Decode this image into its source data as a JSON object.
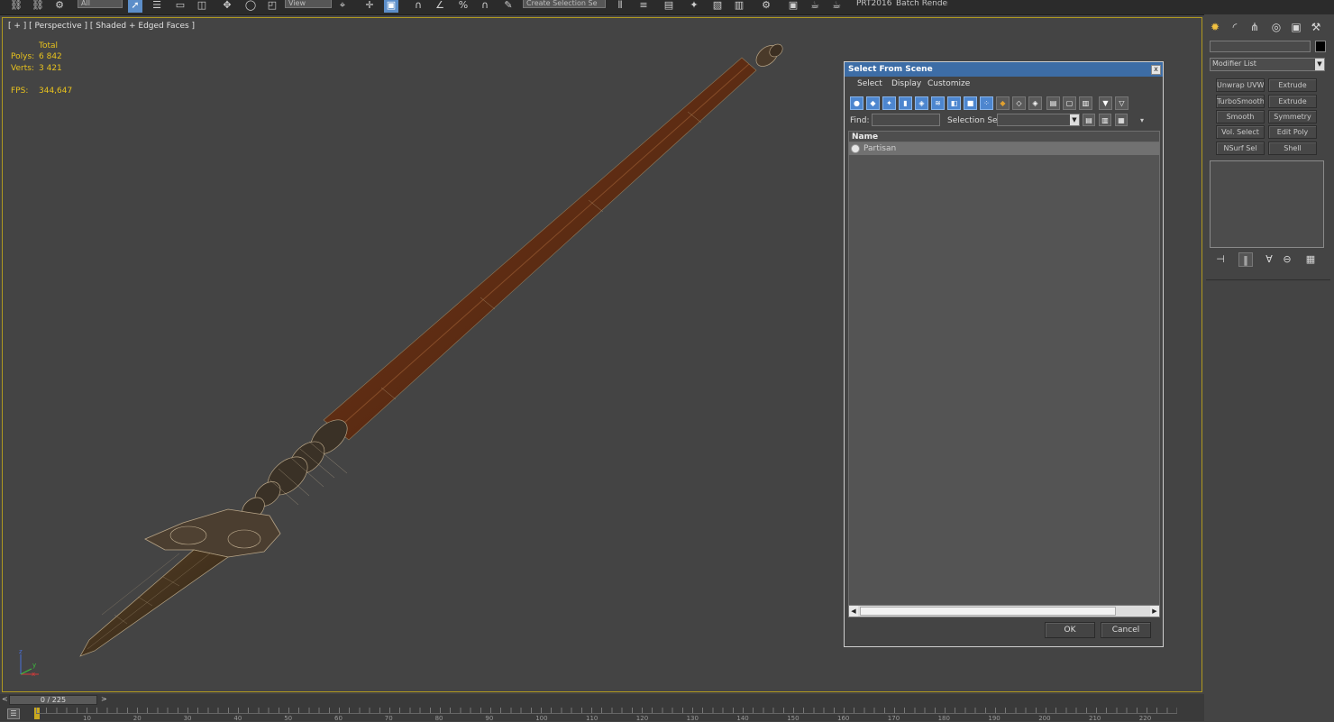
{
  "toolbar": {
    "filter_value": "All",
    "ref_coord_value": "View",
    "named_set_placeholder": "Create Selection Se",
    "prt_label": "PRT2016",
    "batch_render_label": "Batch Render.."
  },
  "viewport": {
    "label": "[ + ] [ Perspective ] [ Shaded + Edged Faces ]",
    "stats": {
      "total_label": "Total",
      "polys_label": "Polys:",
      "polys_value": "6 842",
      "verts_label": "Verts:",
      "verts_value": "3 421",
      "fps_label": "FPS:",
      "fps_value": "344,647"
    },
    "axis_labels": {
      "x": "x",
      "y": "y",
      "z": "z"
    }
  },
  "dialog": {
    "title": "Select From Scene",
    "close": "x",
    "menu": [
      "Select",
      "Display",
      "Customize"
    ],
    "find_label": "Find:",
    "find_value": "",
    "selection_set_label": "Selection Set:",
    "selection_set_value": "",
    "column_name": "Name",
    "rows": [
      "Partisan"
    ],
    "ok": "OK",
    "cancel": "Cancel"
  },
  "command_panel": {
    "modifier_list": "Modifier List",
    "modifiers": [
      [
        "Unwrap UVW",
        "Extrude"
      ],
      [
        "TurboSmooth",
        "Extrude"
      ],
      [
        "Smooth",
        "Symmetry"
      ],
      [
        "Vol. Select",
        "Edit Poly"
      ],
      [
        "NSurf Sel",
        "Shell"
      ]
    ]
  },
  "timeline": {
    "frame_display": "0 / 225",
    "ticks": [
      "10",
      "20",
      "30",
      "40",
      "50",
      "60",
      "70",
      "80",
      "90",
      "100",
      "110",
      "120",
      "130",
      "140",
      "150",
      "160",
      "170",
      "180",
      "190",
      "200",
      "210",
      "220"
    ]
  },
  "colors": {
    "accent": "#3d6da6",
    "viewport_border": "#b0991f",
    "stats_text": "#e8c21d",
    "active_tool": "#5c8ec9"
  }
}
